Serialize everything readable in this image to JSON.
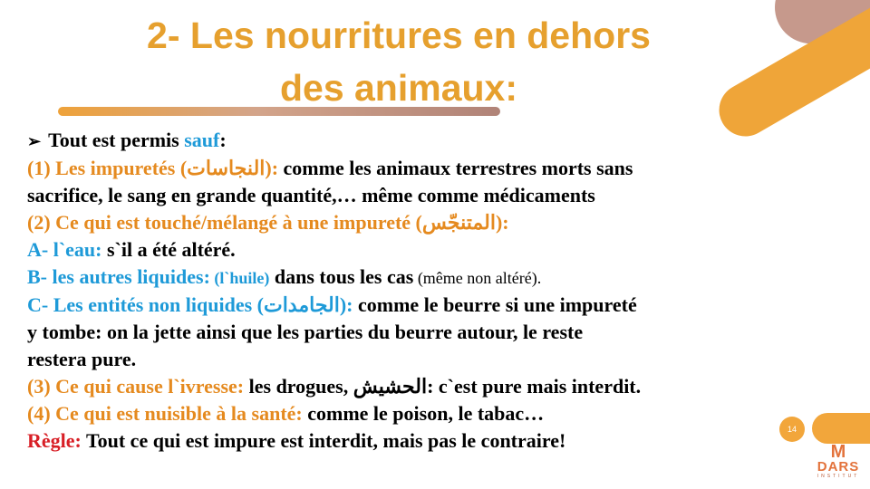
{
  "title": {
    "line1": "2- Les nourritures en dehors",
    "line2": "des animaux:"
  },
  "content": {
    "intro": {
      "arrow": "➢",
      "text": "Tout est permis ",
      "highlight": "sauf",
      "end": ":"
    },
    "item1": {
      "label": "(1) Les impuretés (",
      "arabic": "النجاسات",
      "label_end": "):",
      "text": " comme les animaux terrestres morts sans",
      "line2": "sacrifice, le sang en grande quantité,… même comme médicaments"
    },
    "item2": {
      "label": "(2) Ce qui est touché/mélangé à une impureté (",
      "arabic": "المتنجّس",
      "label_end": "):"
    },
    "itemA": {
      "label": "A- l`eau:",
      "text": " s`il a été altéré."
    },
    "itemB": {
      "label": "B- les autres liquides:",
      "paren": " (l`huile)",
      "text": " dans tous les cas",
      "note": " (même non altéré)."
    },
    "itemC": {
      "label": "C- Les entités non liquides (",
      "arabic": "الجامدات",
      "label_end": "):",
      "text": " comme le beurre si une impureté",
      "line2": "y tombe: on la jette ainsi que les parties du beurre autour, le reste",
      "line3": "restera pure."
    },
    "item3": {
      "label": "(3) Ce qui cause l`ivresse:",
      "text": "  les drogues, ",
      "arabic": "الحشيش",
      "text_end": ": c`est pure mais interdit."
    },
    "item4": {
      "label": "(4) Ce qui est nuisible à la santé:",
      "text": " comme le poison, le tabac…"
    },
    "rule": {
      "label": "Règle:",
      "text": " Tout ce qui est impure est interdit, mais pas le contraire!"
    }
  },
  "page_number": "14",
  "logo": {
    "mark": "M",
    "name": "DARS",
    "subtitle": "INSTITUT"
  },
  "colors": {
    "title": "#E6A02E",
    "orange": "#E58A1F",
    "blue": "#1E9AD8",
    "red": "#D81F26"
  }
}
